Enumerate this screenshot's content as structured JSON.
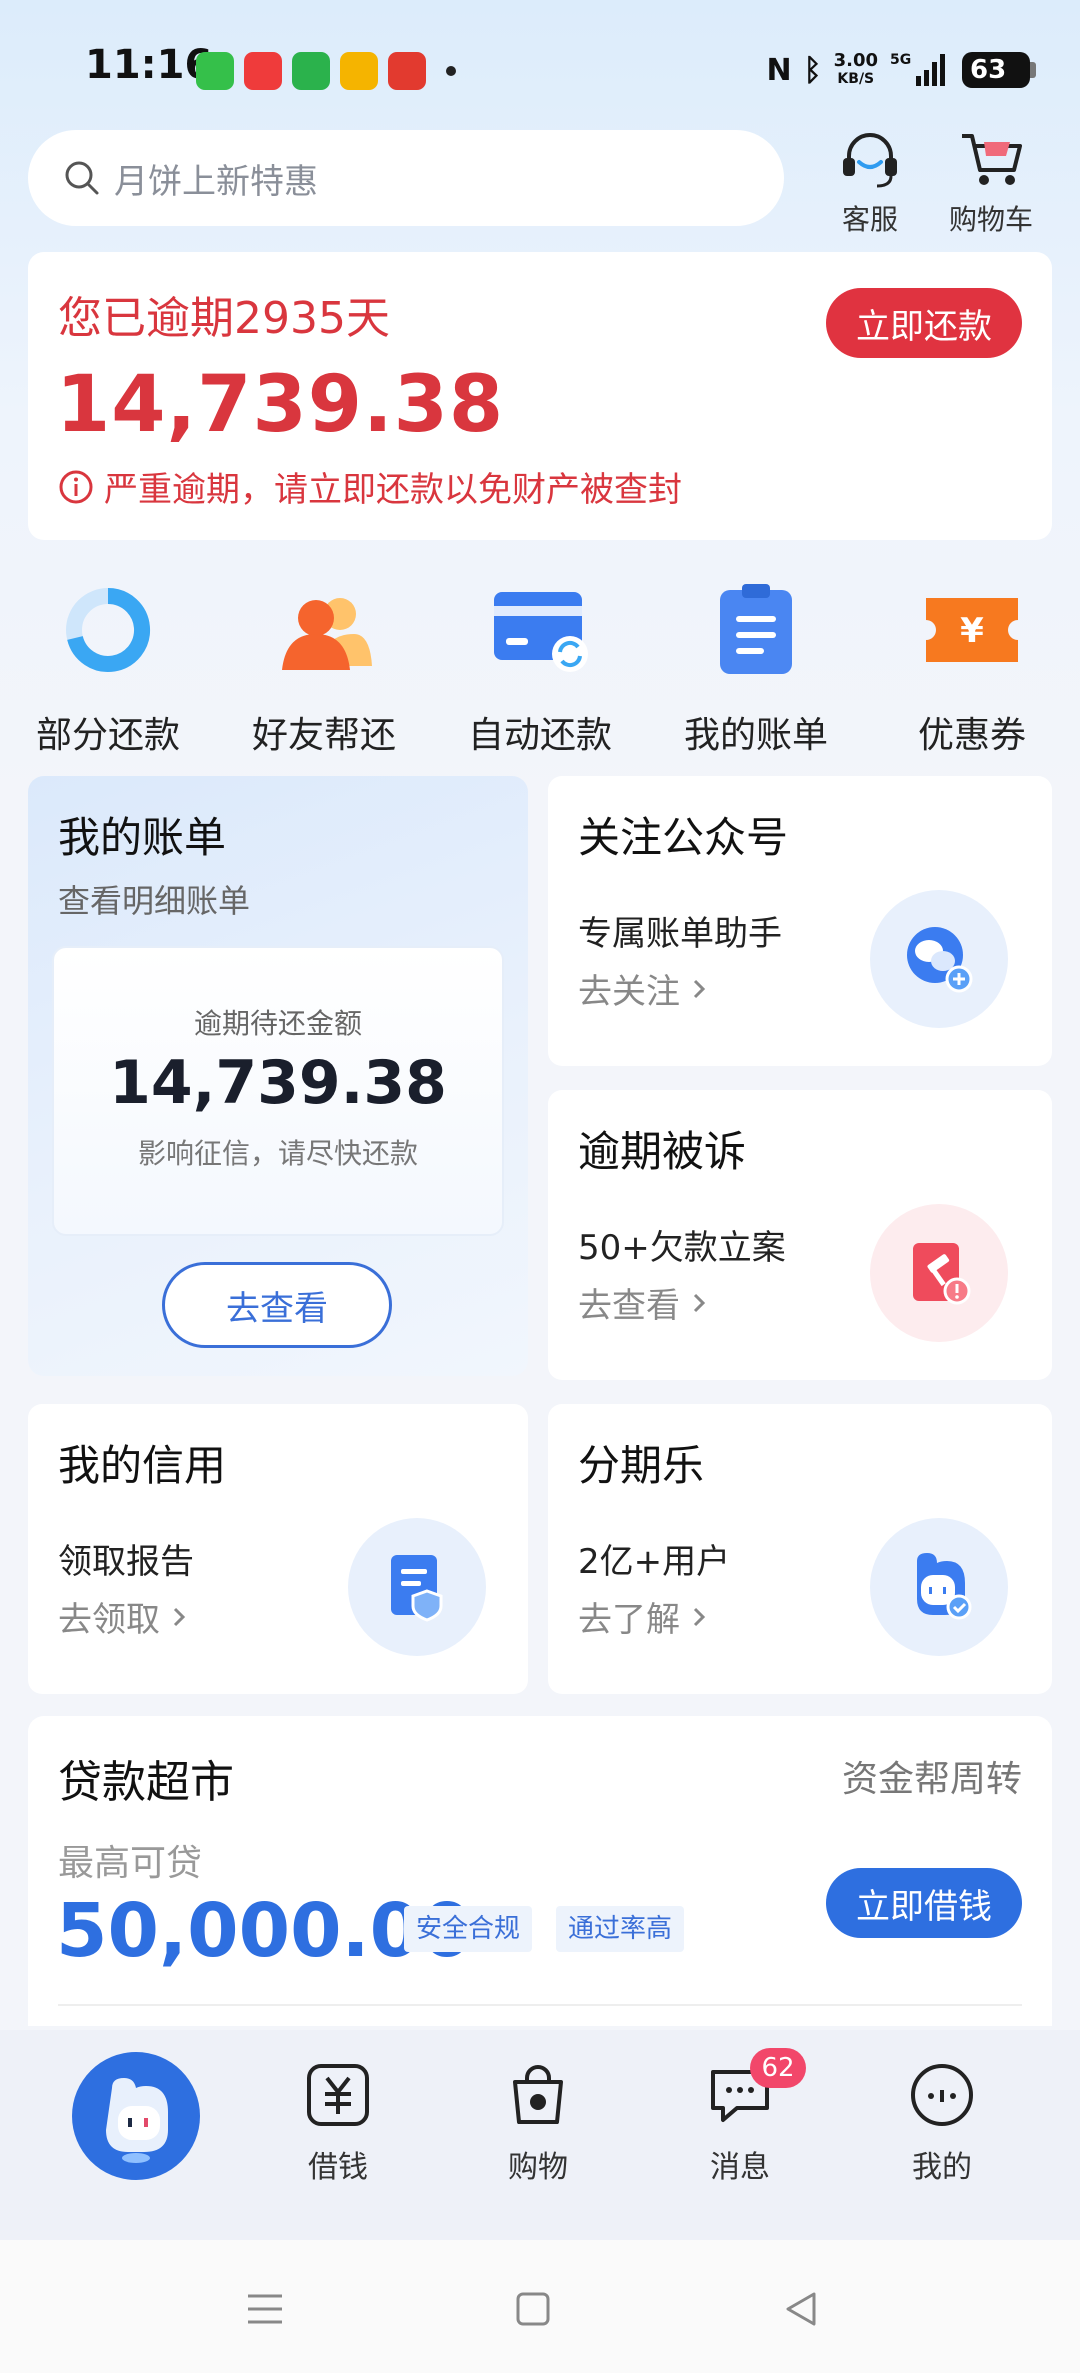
{
  "status_bar": {
    "time": "11:16",
    "net_speed_value": "3.00",
    "net_speed_unit": "KB/S",
    "network": "5G",
    "battery": "63"
  },
  "search": {
    "placeholder": "月饼上新特惠"
  },
  "header_actions": {
    "service": "客服",
    "cart": "购物车"
  },
  "overdue": {
    "title": "您已逾期2935天",
    "amount": "14,739.38",
    "warning": "严重逾期，请立即还款以免财产被查封",
    "repay_label": "立即还款"
  },
  "quick_actions": [
    {
      "label": "部分还款",
      "icon": "donut-chart-icon"
    },
    {
      "label": "好友帮还",
      "icon": "friends-icon"
    },
    {
      "label": "自动还款",
      "icon": "card-refresh-icon"
    },
    {
      "label": "我的账单",
      "icon": "clipboard-icon"
    },
    {
      "label": "优惠券",
      "icon": "coupon-icon"
    }
  ],
  "bill_card": {
    "title": "我的账单",
    "subtitle": "查看明细账单",
    "inner_label": "逾期待还金额",
    "inner_amount": "14,739.38",
    "inner_note": "影响征信，请尽快还款",
    "button": "去查看"
  },
  "follow_card": {
    "title": "关注公众号",
    "subtitle": "专属账单助手",
    "link": "去关注"
  },
  "lawsuit_card": {
    "title": "逾期被诉",
    "subtitle": "50+欠款立案",
    "link": "去查看"
  },
  "credit_card": {
    "title": "我的信用",
    "subtitle": "领取报告",
    "link": "去领取"
  },
  "installment_card": {
    "title": "分期乐",
    "subtitle": "2亿+用户",
    "link": "去了解"
  },
  "loan": {
    "title": "贷款超市",
    "right_text": "资金帮周转",
    "sub": "最高可贷",
    "amount": "50,000.00",
    "tags": [
      "安全合规",
      "通过率高"
    ],
    "button": "立即借钱"
  },
  "tabs": [
    {
      "label": "借钱"
    },
    {
      "label": "购物"
    },
    {
      "label": "消息",
      "badge": "62"
    },
    {
      "label": "我的"
    }
  ],
  "colors": {
    "alert_red": "#e03340",
    "brand_blue": "#2e6fe0"
  }
}
